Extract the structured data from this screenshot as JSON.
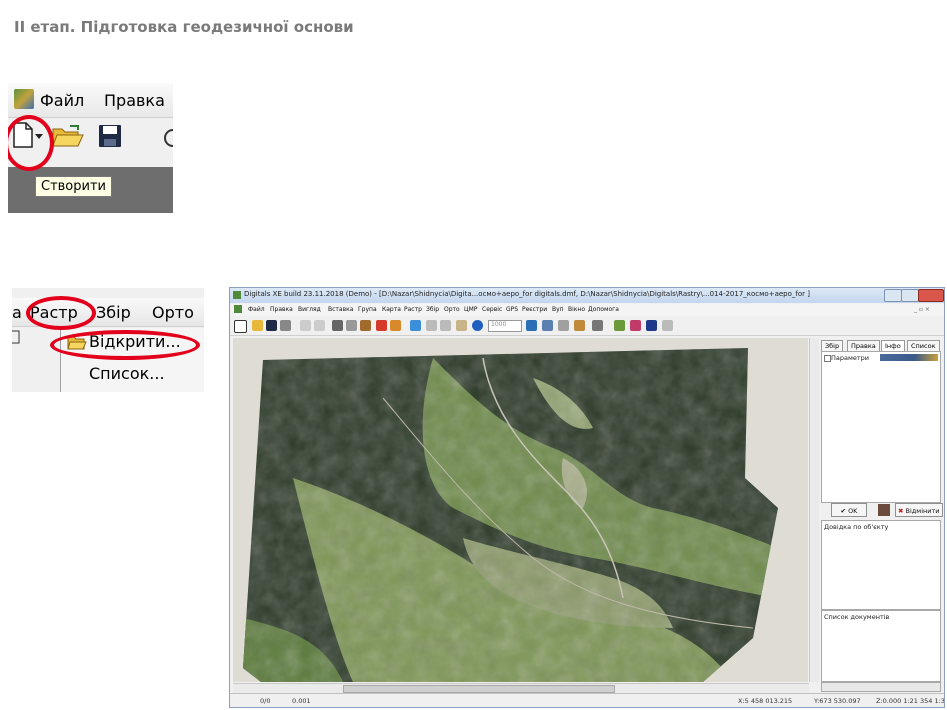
{
  "heading": "II етап. Підготовка геодезичної основи",
  "panel1": {
    "menu": [
      "Файл",
      "Правка"
    ],
    "tooltip": "Створити"
  },
  "panel2": {
    "menu": [
      "а",
      "Растр",
      "Збір",
      "Орто"
    ],
    "dropdown": [
      "Відкрити...",
      "Список..."
    ]
  },
  "window": {
    "title": "Digitals XE build 23.11.2018 (Demo) - [D:\\Nazar\\Shidnycia\\Digita...ocмo+aepo_for digitals.dmf, D:\\Nazar\\Shidnycia\\Digitals\\Rastry\\...014-2017_космо+аеро_for ]",
    "menu": [
      "Файл",
      "Правка",
      "Вигляд",
      "Вставка",
      "Група",
      "Карта",
      "Растр",
      "Збір",
      "Орто",
      "ЦМР",
      "Сервіс",
      "GPS",
      "Реєстри",
      "Вуп",
      "Вікно",
      "Допомога"
    ],
    "zoom_value": "1000",
    "tabs": [
      "Збір",
      "Правка",
      "Інфо",
      "Список"
    ],
    "params_label": "Параметри",
    "ok_label": "OK",
    "cancel_label": "Відмінити",
    "object_info_label": "Довідка по об'єкту",
    "documents_label": "Список документів",
    "status": {
      "page": "0/0",
      "value": "0.001",
      "x": "X:5 458 013.215",
      "y": "Y:673 530.097",
      "z_scale": "Z:0.000   1:21 354 1:32"
    }
  },
  "colors": {
    "annotation_red": "#e3001b",
    "heading_gray": "#7a7a7a",
    "forest_dark": "#2c3a28",
    "meadow_green": "#6e8a4a",
    "canvas_bg": "#dedcd3"
  }
}
